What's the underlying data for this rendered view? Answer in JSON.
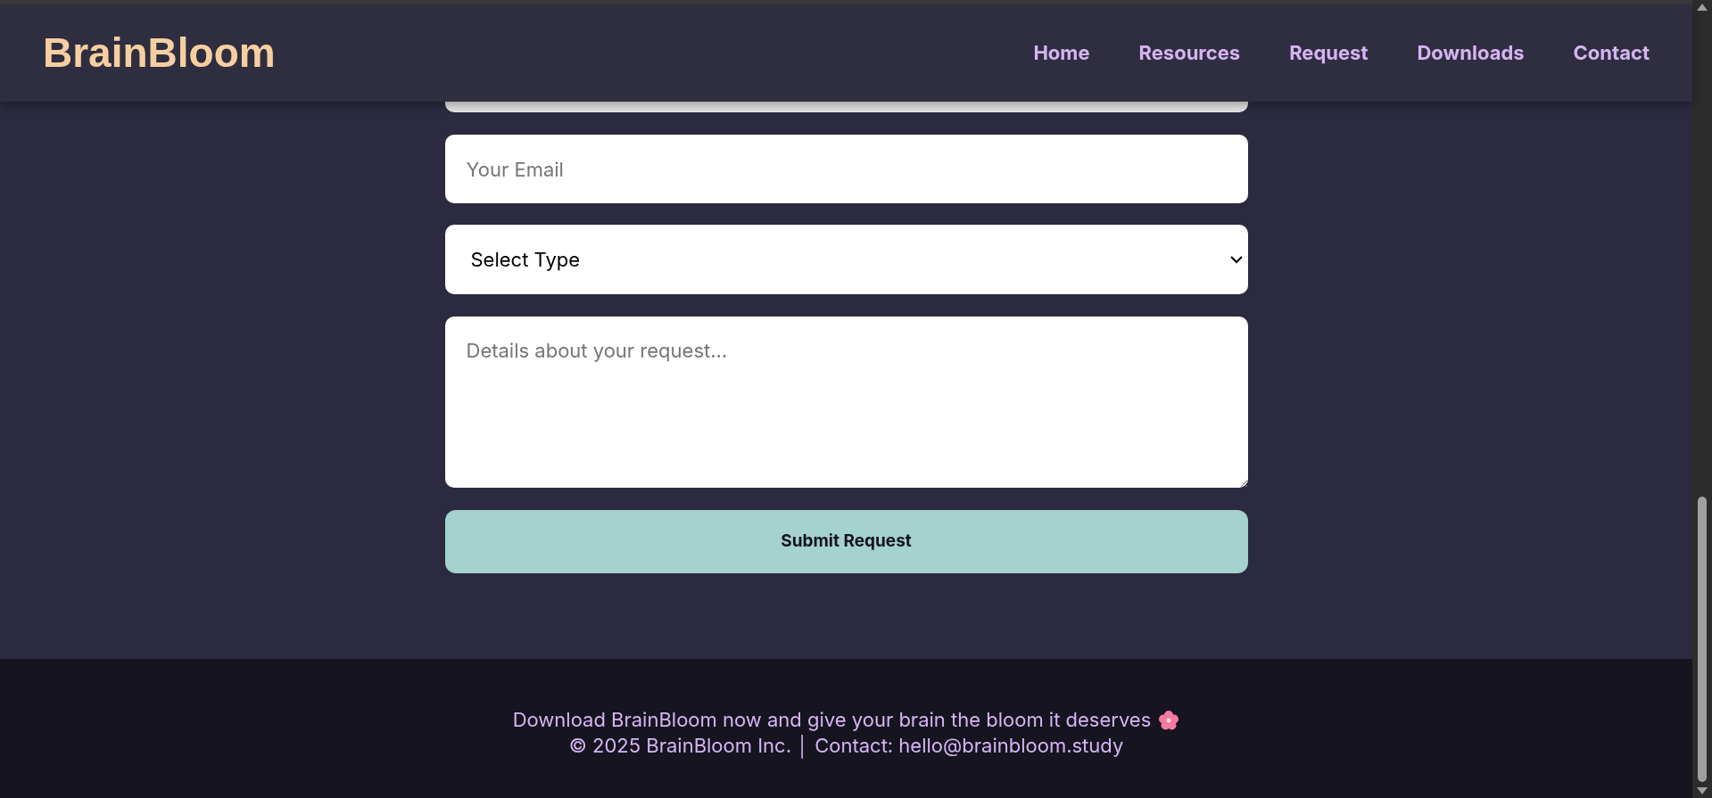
{
  "header": {
    "logo": "BrainBloom",
    "nav": [
      {
        "label": "Home"
      },
      {
        "label": "Resources"
      },
      {
        "label": "Request"
      },
      {
        "label": "Downloads"
      },
      {
        "label": "Contact"
      }
    ]
  },
  "form": {
    "email": {
      "placeholder": "Your Email"
    },
    "type_select": {
      "value": "Select Type"
    },
    "details": {
      "placeholder": "Details about your request..."
    },
    "submit": "Submit Request"
  },
  "footer": {
    "tagline": "Download BrainBloom now and give your brain the bloom it deserves",
    "copyright": "© 2025 BrainBloom Inc. │ Contact: hello@brainbloom.study"
  }
}
